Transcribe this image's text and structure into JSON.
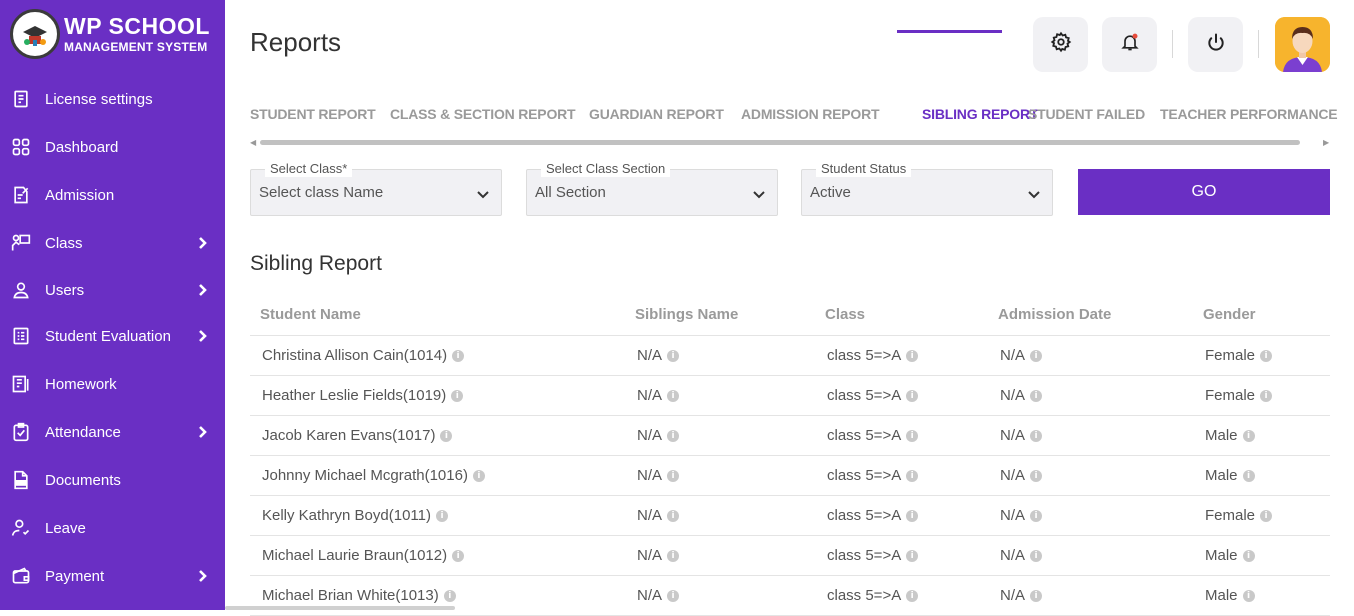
{
  "brand": {
    "title": "WP SCHOOL",
    "subtitle": "MANAGEMENT SYSTEM"
  },
  "colors": {
    "sidebar": "#6a2fc4",
    "accent": "#6a2fc4",
    "avatar_bg": "#f7b42d"
  },
  "sidebar": {
    "items": [
      {
        "label": "License settings",
        "icon": "license-icon",
        "chevron": false
      },
      {
        "label": "Dashboard",
        "icon": "dashboard-grid-icon",
        "chevron": false
      },
      {
        "label": "Admission",
        "icon": "admission-form-icon",
        "chevron": false
      },
      {
        "label": "Class",
        "icon": "class-teacher-icon",
        "chevron": true
      },
      {
        "label": "Users",
        "icon": "user-icon",
        "chevron": true
      },
      {
        "label": "Student Evaluation",
        "icon": "evaluation-checklist-icon",
        "chevron": true
      },
      {
        "label": "Homework",
        "icon": "homework-icon",
        "chevron": false
      },
      {
        "label": "Attendance",
        "icon": "attendance-clipboard-icon",
        "chevron": true
      },
      {
        "label": "Documents",
        "icon": "document-icon",
        "chevron": false
      },
      {
        "label": "Leave",
        "icon": "leave-user-icon",
        "chevron": false
      },
      {
        "label": "Payment",
        "icon": "wallet-icon",
        "chevron": true
      }
    ]
  },
  "header": {
    "title": "Reports",
    "icons": [
      "settings-gear-icon",
      "notification-bell-icon",
      "power-icon",
      "user-avatar"
    ]
  },
  "tabs": [
    {
      "label": "STUDENT REPORT",
      "active": false
    },
    {
      "label": "CLASS & SECTION REPORT",
      "active": false
    },
    {
      "label": "GUARDIAN REPORT",
      "active": false
    },
    {
      "label": "ADMISSION REPORT",
      "active": false
    },
    {
      "label": "SIBLING REPORT",
      "active": true
    },
    {
      "label": "STUDENT FAILED",
      "active": false
    },
    {
      "label": "TEACHER PERFORMANCE",
      "active": false
    }
  ],
  "filters": {
    "class": {
      "label": "Select Class*",
      "value": "Select class Name"
    },
    "section": {
      "label": "Select Class Section",
      "value": "All Section"
    },
    "status": {
      "label": "Student Status",
      "value": "Active"
    },
    "go_label": "GO"
  },
  "report": {
    "title": "Sibling Report",
    "columns": [
      "Student Name",
      "Siblings Name",
      "Class",
      "Admission Date",
      "Gender"
    ],
    "rows": [
      [
        "Christina Allison Cain(1014)",
        "N/A",
        "class 5=>A",
        "N/A",
        "Female"
      ],
      [
        "Heather Leslie Fields(1019)",
        "N/A",
        "class 5=>A",
        "N/A",
        "Female"
      ],
      [
        "Jacob Karen Evans(1017)",
        "N/A",
        "class 5=>A",
        "N/A",
        "Male"
      ],
      [
        "Johnny Michael Mcgrath(1016)",
        "N/A",
        "class 5=>A",
        "N/A",
        "Male"
      ],
      [
        "Kelly Kathryn Boyd(1011)",
        "N/A",
        "class 5=>A",
        "N/A",
        "Female"
      ],
      [
        "Michael Laurie Braun(1012)",
        "N/A",
        "class 5=>A",
        "N/A",
        "Male"
      ],
      [
        "Michael Brian White(1013)",
        "N/A",
        "class 5=>A",
        "N/A",
        "Male"
      ]
    ]
  }
}
